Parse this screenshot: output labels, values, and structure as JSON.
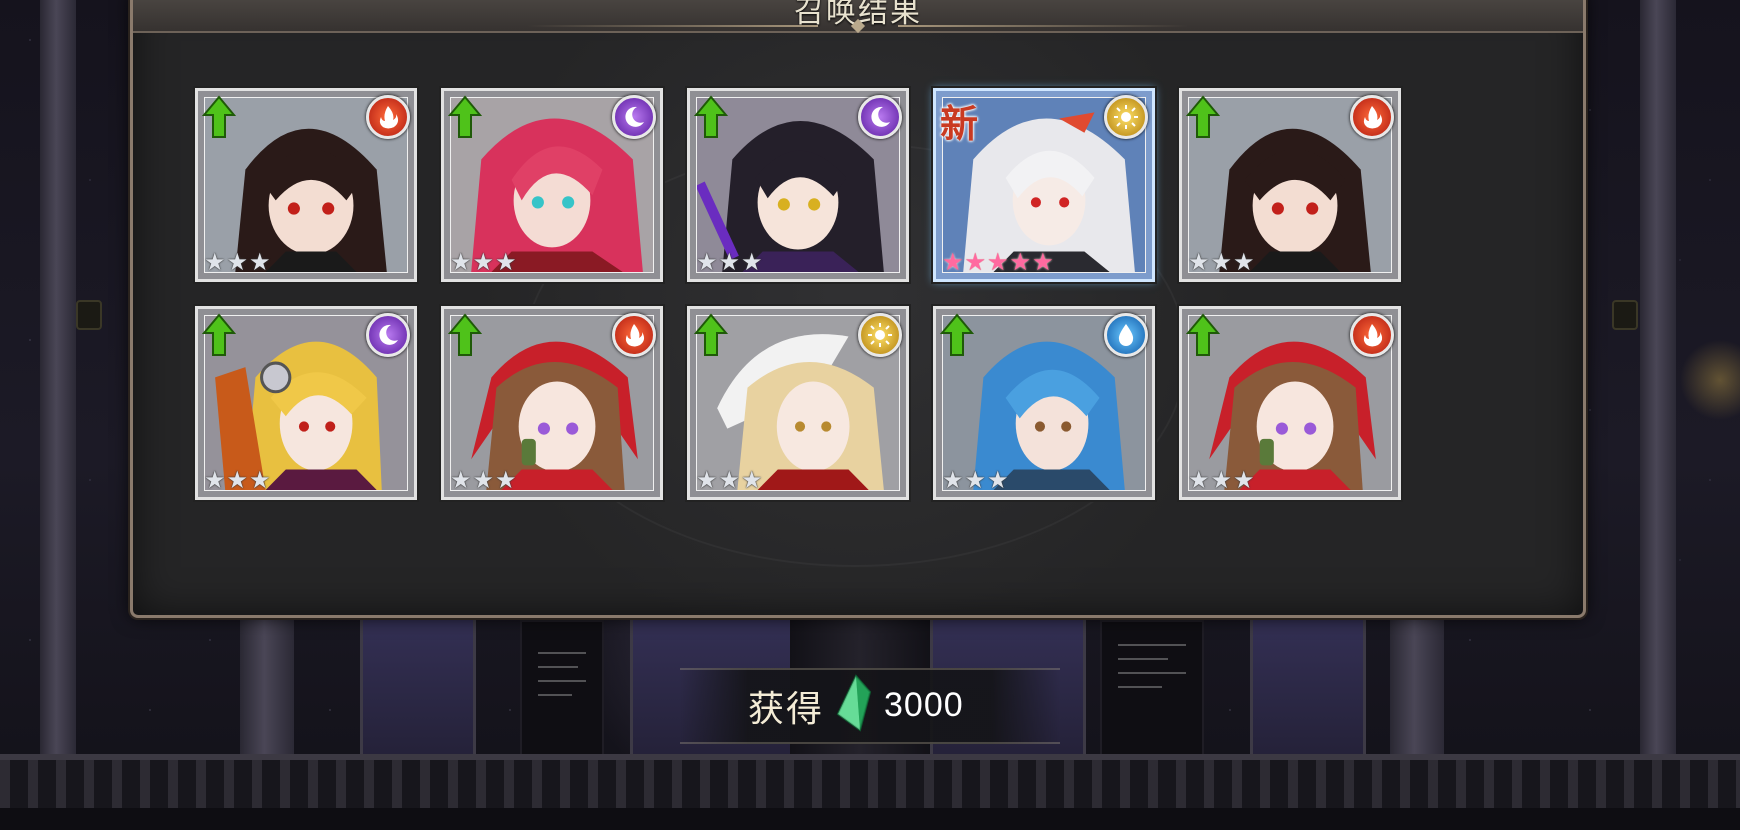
{
  "panel": {
    "title": "召唤结果"
  },
  "colors": {
    "fire": "#d2311c",
    "dark": "#8a3bd6",
    "light": "#e3b21b",
    "water": "#1e86d6",
    "up_arrow": "#4fc21a",
    "new_badge": "#c93a22"
  },
  "cards": [
    {
      "element": "fire-element-icon",
      "stars": 3,
      "is_new": false,
      "rank_up": true
    },
    {
      "element": "dark-element-icon",
      "stars": 3,
      "is_new": false,
      "rank_up": true
    },
    {
      "element": "dark-element-icon",
      "stars": 3,
      "is_new": false,
      "rank_up": true
    },
    {
      "element": "light-element-icon",
      "stars": 5,
      "is_new": true,
      "new_label": "新",
      "rank_up": false
    },
    {
      "element": "fire-element-icon",
      "stars": 3,
      "is_new": false,
      "rank_up": true
    },
    {
      "element": "dark-element-icon",
      "stars": 3,
      "is_new": false,
      "rank_up": true
    },
    {
      "element": "fire-element-icon",
      "stars": 3,
      "is_new": false,
      "rank_up": true
    },
    {
      "element": "light-element-icon",
      "stars": 3,
      "is_new": false,
      "rank_up": true
    },
    {
      "element": "water-element-icon",
      "stars": 3,
      "is_new": false,
      "rank_up": true
    },
    {
      "element": "fire-element-icon",
      "stars": 3,
      "is_new": false,
      "rank_up": true
    }
  ],
  "reward": {
    "label": "获得",
    "icon": "green-crystal-icon",
    "amount": "3000"
  }
}
